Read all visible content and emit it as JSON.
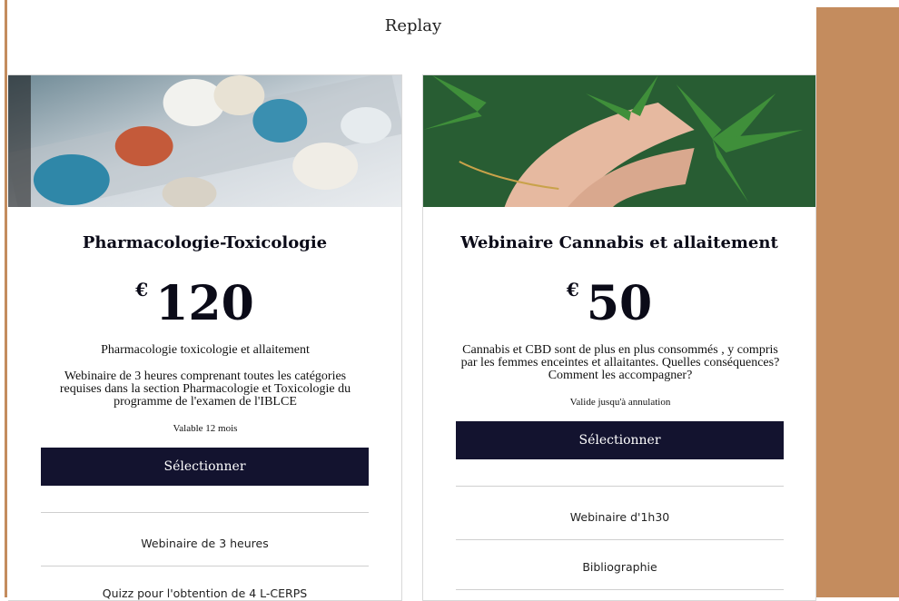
{
  "header": {
    "title": "Replay"
  },
  "plans": [
    {
      "image_alt": "pills-image",
      "title": "Pharmacologie-Toxicologie",
      "currency": "€",
      "price": "120",
      "desc1": "Pharmacologie toxicologie et allaitement",
      "desc2": "Webinaire de 3 heures comprenant toutes les catégories requises dans la section Pharmacologie et Toxicologie du programme de l'examen de l'IBLCE",
      "validity": "Valable 12 mois",
      "button": "Sélectionner",
      "features": [
        "Webinaire de 3 heures",
        "Quizz pour l'obtention de 4 L-CERPS"
      ]
    },
    {
      "image_alt": "cannabis-image",
      "title": "Webinaire Cannabis et allaitement",
      "currency": "€",
      "price": "50",
      "desc1": "Cannabis et CBD sont de plus en plus consommés , y compris par les femmes enceintes et allaitantes. Quelles conséquences? Comment les accompagner?",
      "validity": "Valide jusqu'à annulation",
      "button": "Sélectionner",
      "features": [
        "Webinaire d'1h30",
        "Bibliographie"
      ]
    }
  ],
  "colors": {
    "accent": "#c48c5e",
    "button": "#13132f"
  }
}
